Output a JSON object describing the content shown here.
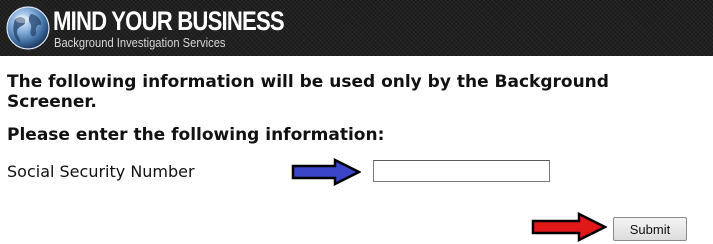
{
  "header": {
    "brand_name": "MIND YOUR BUSINESS",
    "tagline": "Background Investigation Services",
    "logo_icon": "globe-icon",
    "background_color": "#1b1b1b"
  },
  "form": {
    "notice": "The following information will be used only by the Background Screener.",
    "prompt": "Please enter the following information:",
    "ssn": {
      "label": "Social Security Number",
      "value": "",
      "arrow_icon": "right-arrow-icon",
      "arrow_color": "#3a45c8"
    },
    "submit": {
      "label": "Submit",
      "arrow_icon": "right-arrow-icon",
      "arrow_color": "#e01818"
    }
  }
}
